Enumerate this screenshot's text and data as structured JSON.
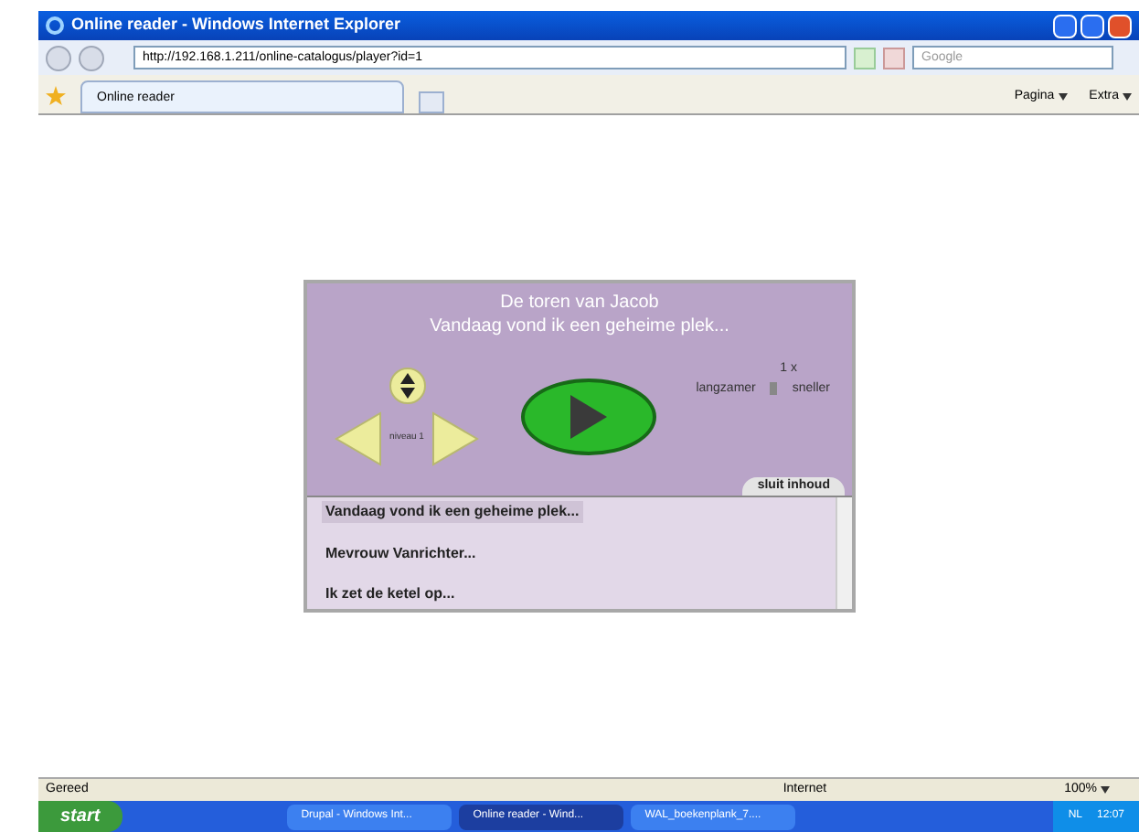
{
  "window": {
    "title": "Online reader - Windows Internet Explorer"
  },
  "address_bar": {
    "url": "http://192.168.1.211/online-catalogus/player?id=1",
    "search_placeholder": "Google"
  },
  "tabs": [
    {
      "label": "Online reader",
      "selected": true
    }
  ],
  "command_bar": [
    "Pagina",
    "Extra"
  ],
  "player": {
    "title": "De toren van Jacob",
    "subtitle": "Vandaag vond ik een geheime plek...",
    "level_label": "niveau 1",
    "speed": "1 x",
    "slower": "langzamer",
    "faster": "sneller",
    "close_contents": "sluit inhoud",
    "chapters": [
      {
        "label": "Vandaag vond ik een geheime plek...",
        "selected": true
      },
      {
        "label": "Mevrouw Vanrichter...",
        "selected": false
      },
      {
        "label": "Ik zet de ketel op...",
        "selected": false
      }
    ]
  },
  "status_bar": {
    "text": "Gereed",
    "zone": "Internet",
    "zoom": "100%"
  },
  "taskbar": {
    "start": "start",
    "tasks": [
      {
        "label": "Drupal - Windows Int...",
        "selected": false
      },
      {
        "label": "Online reader - Wind...",
        "selected": true
      },
      {
        "label": "WAL_boekenplank_7....",
        "selected": false
      }
    ],
    "language": "NL",
    "clock": "12:07"
  }
}
